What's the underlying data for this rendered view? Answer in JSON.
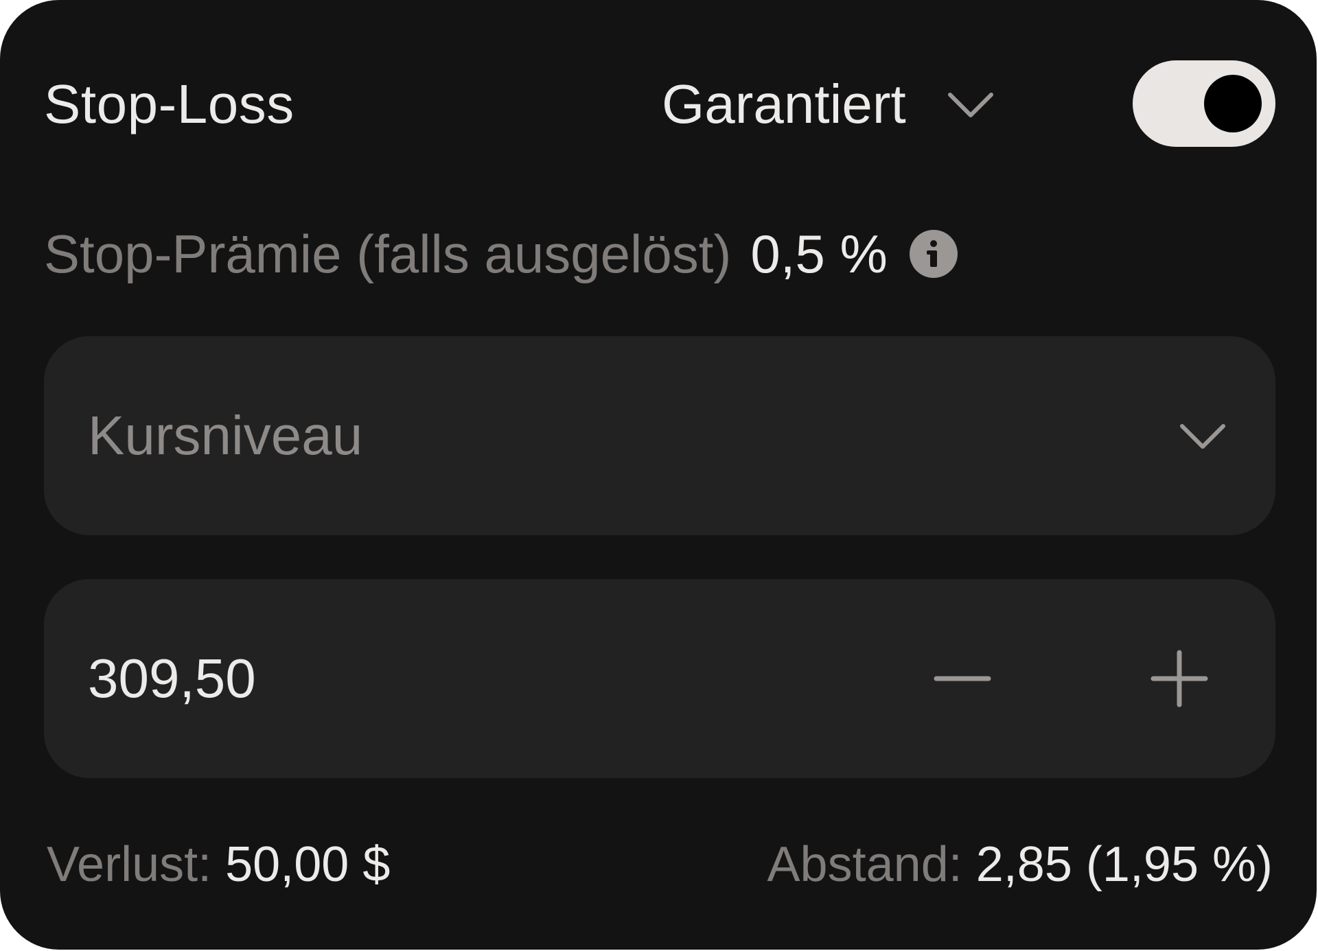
{
  "header": {
    "title": "Stop-Loss",
    "type_selected": "Garantiert",
    "type_chevron_icon": "chevron-down-icon",
    "toggle_on": true
  },
  "premium": {
    "label": "Stop-Prämie (falls ausgelöst)",
    "value": "0,5 %",
    "icon": "info-icon"
  },
  "level_select": {
    "placeholder": "Kursniveau",
    "icon": "chevron-down-icon"
  },
  "price_input": {
    "value": "309,50",
    "minus_icon": "minus-icon",
    "plus_icon": "plus-icon"
  },
  "footer": {
    "loss_label": "Verlust:",
    "loss_value": "50,00 $",
    "distance_label": "Abstand:",
    "distance_value": "2,85 (1,95 %)"
  },
  "colors": {
    "panel_bg": "#141314",
    "field_bg": "#232223",
    "text_primary": "#ecebea",
    "text_muted": "#807c7a",
    "toggle_track": "#e9e6e4",
    "toggle_knob": "#000000"
  }
}
